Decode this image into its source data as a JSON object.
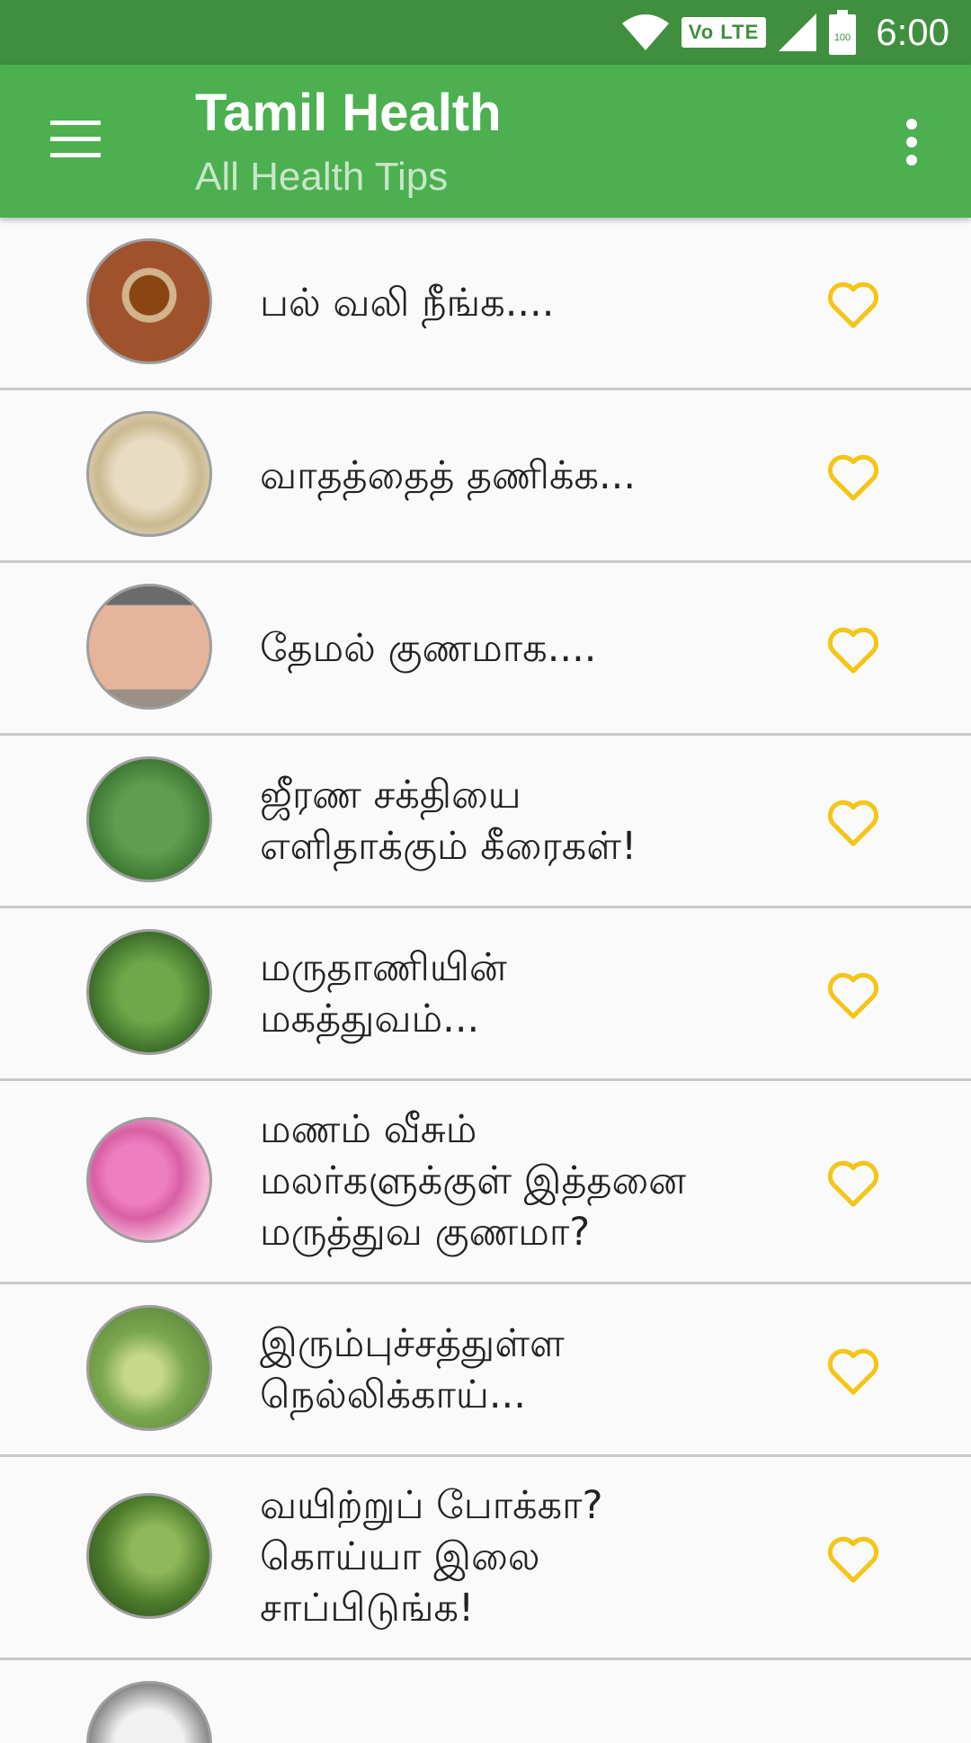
{
  "status_bar": {
    "volte": "Vo LTE",
    "battery": "100",
    "time": "6:00"
  },
  "app_bar": {
    "title": "Tamil Health",
    "subtitle": "All Health Tips"
  },
  "colors": {
    "status_bar": "#3f8f3f",
    "app_bar": "#4caf50",
    "heart": "#f5c518"
  },
  "tips": [
    {
      "title": "பல் வலி நீங்க...."
    },
    {
      "title": "வாதத்தைத் தணிக்க..."
    },
    {
      "title": "தேமல் குணமாக...."
    },
    {
      "title": "ஜீரண சக்தியை\nஎளிதாக்கும் கீரைகள்!"
    },
    {
      "title": "மருதாணியின்\nமகத்துவம்..."
    },
    {
      "title": "மணம் வீசும்\nமலர்களுக்குள் இத்தனை\nமருத்துவ குணமா?"
    },
    {
      "title": "இரும்புச்சத்துள்ள\nநெல்லிக்காய்..."
    },
    {
      "title": "வயிற்றுப் போக்கா?\nகொய்யா இலை\nசாப்பிடுங்க!"
    }
  ]
}
